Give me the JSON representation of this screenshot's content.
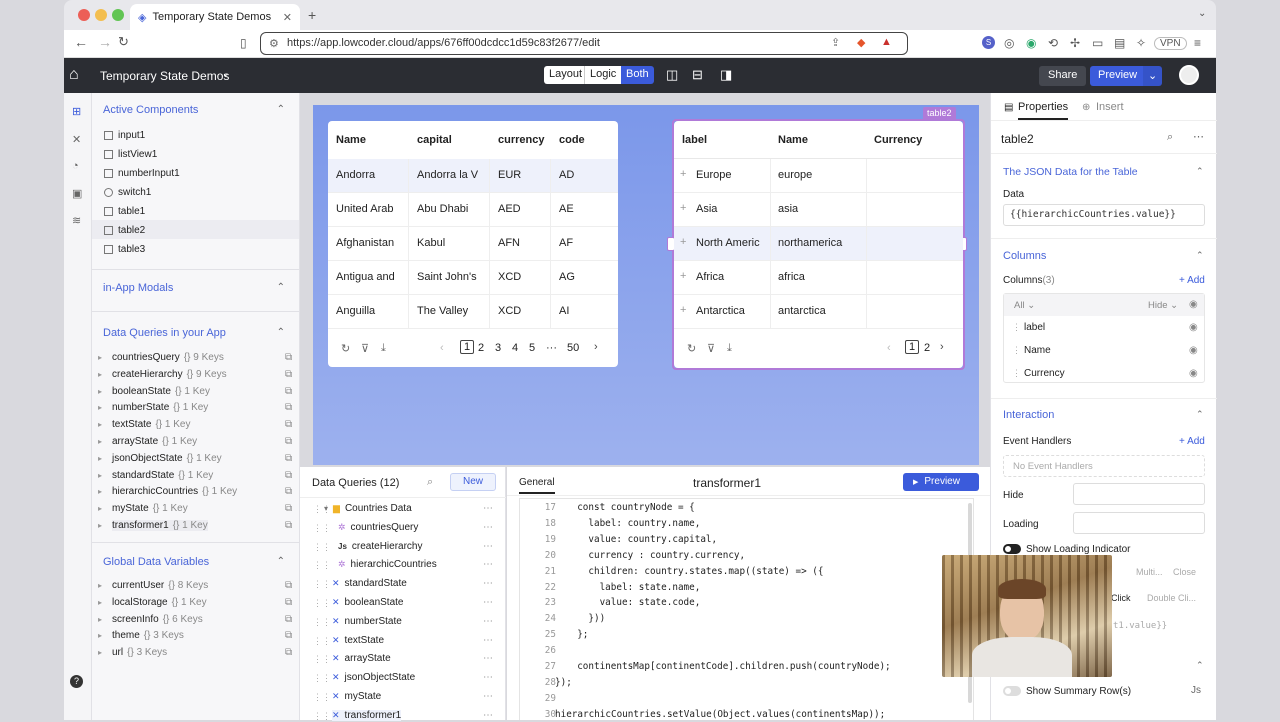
{
  "browser": {
    "tab_title": "Temporary State Demos",
    "url": "https://app.lowcoder.cloud/apps/676ff00dcdcc1d59c83f2677/edit",
    "vpn": "VPN"
  },
  "app": {
    "title": "Temporary State Demos",
    "modes": [
      "Layout",
      "Logic",
      "Both"
    ],
    "share": "Share",
    "preview": "Preview"
  },
  "left": {
    "active_components_title": "Active Components",
    "components": [
      "input1",
      "listView1",
      "numberInput1",
      "switch1",
      "table1",
      "table2",
      "table3"
    ],
    "modals_title": "in-App Modals",
    "queries_title": "Data Queries in your App",
    "queries": [
      {
        "name": "countriesQuery",
        "keys": "{} 9 Keys"
      },
      {
        "name": "createHierarchy",
        "keys": "{} 9 Keys"
      },
      {
        "name": "booleanState",
        "keys": "{} 1 Key"
      },
      {
        "name": "numberState",
        "keys": "{} 1 Key"
      },
      {
        "name": "textState",
        "keys": "{} 1 Key"
      },
      {
        "name": "arrayState",
        "keys": "{} 1 Key"
      },
      {
        "name": "jsonObjectState",
        "keys": "{} 1 Key"
      },
      {
        "name": "standardState",
        "keys": "{} 1 Key"
      },
      {
        "name": "hierarchicCountries",
        "keys": "{} 1 Key"
      },
      {
        "name": "myState",
        "keys": "{} 1 Key"
      },
      {
        "name": "transformer1",
        "keys": "{} 1 Key"
      }
    ],
    "globals_title": "Global Data Variables",
    "globals": [
      {
        "name": "currentUser",
        "keys": "{} 8 Keys"
      },
      {
        "name": "localStorage",
        "keys": "{} 1 Key"
      },
      {
        "name": "screenInfo",
        "keys": "{} 6 Keys"
      },
      {
        "name": "theme",
        "keys": "{} 3 Keys"
      },
      {
        "name": "url",
        "keys": "{} 3 Keys"
      }
    ]
  },
  "table1": {
    "headers": [
      "Name",
      "capital",
      "currency",
      "code"
    ],
    "rows": [
      [
        "Andorra",
        "Andorra la V",
        "EUR",
        "AD"
      ],
      [
        "United Arab",
        "Abu Dhabi",
        "AED",
        "AE"
      ],
      [
        "Afghanistan",
        "Kabul",
        "AFN",
        "AF"
      ],
      [
        "Antigua and",
        "Saint John's",
        "XCD",
        "AG"
      ],
      [
        "Anguilla",
        "The Valley",
        "XCD",
        "AI"
      ]
    ],
    "pages": [
      "1",
      "2",
      "3",
      "4",
      "5",
      "···",
      "50"
    ]
  },
  "table2": {
    "tag": "table2",
    "headers": [
      "label",
      "Name",
      "Currency"
    ],
    "rows": [
      [
        "Europe",
        "europe",
        ""
      ],
      [
        "Asia",
        "asia",
        ""
      ],
      [
        "North Americ",
        "northamerica",
        ""
      ],
      [
        "Africa",
        "africa",
        ""
      ],
      [
        "Antarctica",
        "antarctica",
        ""
      ]
    ],
    "pages": [
      "1",
      "2"
    ]
  },
  "queries_panel": {
    "title": "Data Queries (12)",
    "new": "New",
    "items": [
      {
        "name": "Countries Data",
        "icon": "folder"
      },
      {
        "name": "countriesQuery",
        "icon": "query"
      },
      {
        "name": "createHierarchy",
        "icon": "js"
      },
      {
        "name": "hierarchicCountries",
        "icon": "query"
      },
      {
        "name": "standardState",
        "icon": "state"
      },
      {
        "name": "booleanState",
        "icon": "state"
      },
      {
        "name": "numberState",
        "icon": "state"
      },
      {
        "name": "textState",
        "icon": "state"
      },
      {
        "name": "arrayState",
        "icon": "state"
      },
      {
        "name": "jsonObjectState",
        "icon": "state"
      },
      {
        "name": "myState",
        "icon": "state"
      },
      {
        "name": "transformer1",
        "icon": "state"
      }
    ]
  },
  "editor": {
    "tab": "General",
    "title": "transformer1",
    "preview": "Preview",
    "lines": [
      {
        "n": "17",
        "t": "  const countryNode = {"
      },
      {
        "n": "18",
        "t": "    label: country.name,"
      },
      {
        "n": "19",
        "t": "    value: country.capital,"
      },
      {
        "n": "20",
        "t": "    currency : country.currency,"
      },
      {
        "n": "21",
        "t": "    children: country.states.map((state) => ({"
      },
      {
        "n": "22",
        "t": "      label: state.name,"
      },
      {
        "n": "23",
        "t": "      value: state.code,"
      },
      {
        "n": "24",
        "t": "    }))"
      },
      {
        "n": "25",
        "t": "  };"
      },
      {
        "n": "26",
        "t": ""
      },
      {
        "n": "27",
        "t": "  continentsMap[continentCode].children.push(countryNode);"
      },
      {
        "n": "28",
        "t": "});"
      },
      {
        "n": "29",
        "t": ""
      },
      {
        "n": "30",
        "t": "hierarchicCountries.setValue(Object.values(continentsMap));"
      }
    ]
  },
  "right": {
    "tabs": [
      "Properties",
      "Insert"
    ],
    "component": "table2",
    "json_section": "The JSON Data for the Table",
    "data_label": "Data",
    "data_value": "{{hierarchicCountries.value}}",
    "columns_section": "Columns",
    "columns_label": "Columns",
    "columns_count": "(3)",
    "add": "+ Add",
    "all": "All",
    "hide": "Hide",
    "columns": [
      "label",
      "Name",
      "Currency"
    ],
    "interaction": "Interaction",
    "event_handlers": "Event Handlers",
    "no_handlers": "No Event Handlers",
    "hide_label": "Hide",
    "loading_label": "Loading",
    "show_loading": "Show Loading Indicator",
    "multi": "Multi...",
    "close": "Close",
    "click": "Click",
    "double_click": "Double Cli...",
    "partial": "t1.value}}",
    "summary": "Show Summary Row(s)"
  },
  "colors": {
    "accent": "#4965d8",
    "primary_btn": "#3b5bdb",
    "header_bg": "#2b2d33",
    "canvas": "#8aa3ec",
    "selected_border": "#b07ad8"
  }
}
